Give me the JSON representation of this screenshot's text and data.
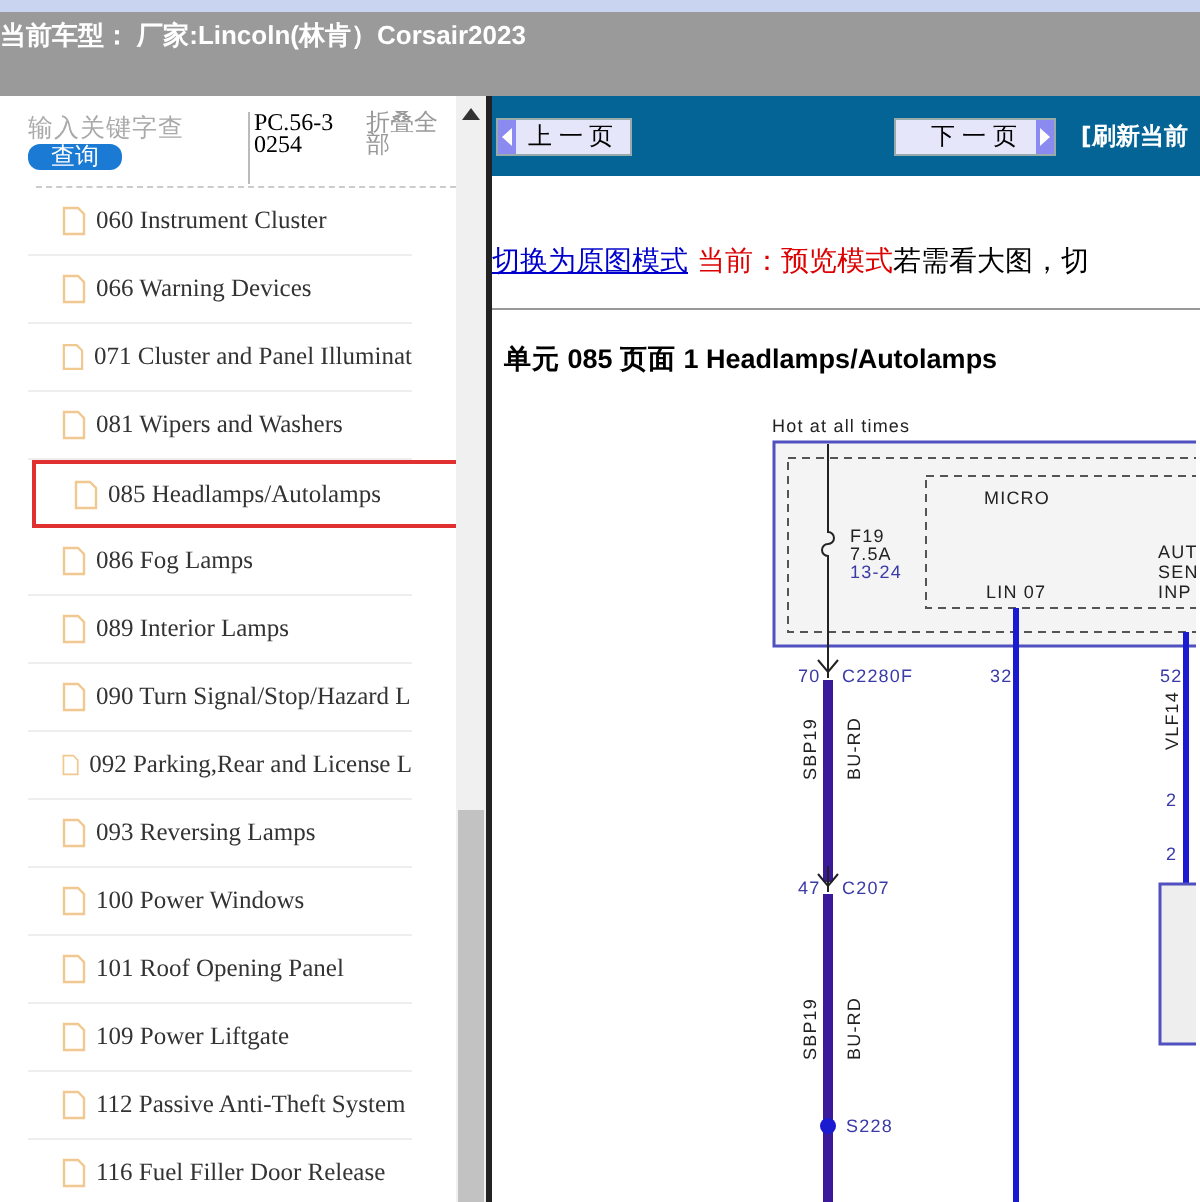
{
  "window": {
    "title": "当前车型： 厂家:Lincoln(林肯）Corsair2023"
  },
  "sidebar": {
    "search": {
      "placeholder": "输入关键字查"
    },
    "search_button": "查询",
    "code": "PC.56-30254",
    "collapse_all": "折叠全部",
    "items": [
      {
        "label": "060 Instrument Cluster",
        "selected": false
      },
      {
        "label": "066 Warning Devices",
        "selected": false
      },
      {
        "label": "071 Cluster and Panel Illuminat",
        "selected": false
      },
      {
        "label": "081 Wipers and Washers",
        "selected": false
      },
      {
        "label": "085 Headlamps/Autolamps",
        "selected": true
      },
      {
        "label": "086 Fog Lamps",
        "selected": false
      },
      {
        "label": "089 Interior Lamps",
        "selected": false
      },
      {
        "label": "090 Turn Signal/Stop/Hazard L",
        "selected": false
      },
      {
        "label": "092 Parking,Rear and License L",
        "selected": false
      },
      {
        "label": "093 Reversing Lamps",
        "selected": false
      },
      {
        "label": "100 Power Windows",
        "selected": false
      },
      {
        "label": "101 Roof Opening Panel",
        "selected": false
      },
      {
        "label": "109 Power Liftgate",
        "selected": false
      },
      {
        "label": "112 Passive Anti-Theft System",
        "selected": false
      },
      {
        "label": "116 Fuel Filler Door Release",
        "selected": false
      }
    ]
  },
  "toolbar": {
    "prev": "上 一 页",
    "next": "下 一 页",
    "refresh": "[刷新当前"
  },
  "mode_line": {
    "link": "切换为原图模式",
    "current": " 当前：预览模式",
    "hint": "若需看大图，切"
  },
  "page_title": "单元 085 页面 1 Headlamps/Autolamps",
  "diagram": {
    "supply": "Hot at all times",
    "module": "MICRO",
    "fuse": [
      "F19",
      "7.5A",
      "13-24"
    ],
    "lin": "LIN 07",
    "sensor": [
      "AUT",
      "SEN",
      "INP"
    ],
    "connectors": [
      {
        "pin": "70",
        "name": "C2280F"
      },
      {
        "pin": "47",
        "name": "C207"
      }
    ],
    "circuits": [
      {
        "code": "SBP19",
        "wire_color": "BU-RD"
      },
      {
        "code": "SBP19",
        "wire_color": "BU-RD"
      }
    ],
    "splice": "S228",
    "pin_lin": "32",
    "pin_sensor": "52",
    "sensor_circuit": "VLF14",
    "sensor_pins": [
      "2",
      "2"
    ]
  }
}
